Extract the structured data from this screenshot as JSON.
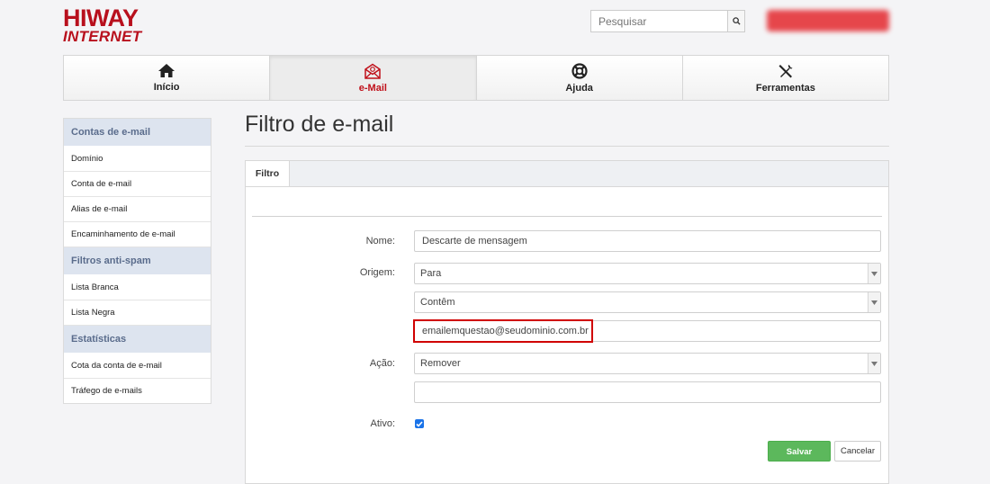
{
  "brand": {
    "line1": "HIWAY",
    "line2": "INTERNET"
  },
  "search": {
    "placeholder": "Pesquisar",
    "icon": "search-icon"
  },
  "topnav": {
    "tabs": [
      {
        "label": "Início",
        "icon": "home-icon",
        "active": false
      },
      {
        "label": "e-Mail",
        "icon": "email-icon",
        "active": true
      },
      {
        "label": "Ajuda",
        "icon": "lifebuoy-icon",
        "active": false
      },
      {
        "label": "Ferramentas",
        "icon": "tools-icon",
        "active": false
      }
    ]
  },
  "sidebar": {
    "sections": [
      {
        "title": "Contas de e-mail",
        "items": [
          "Domínio",
          "Conta de e-mail",
          "Alias de e-mail",
          "Encaminhamento de e-mail"
        ]
      },
      {
        "title": "Filtros anti-spam",
        "items": [
          "Lista Branca",
          "Lista Negra"
        ]
      },
      {
        "title": "Estatísticas",
        "items": [
          "Cota da conta de e-mail",
          "Tráfego de e-mails"
        ]
      }
    ]
  },
  "main": {
    "title": "Filtro de e-mail",
    "tab": "Filtro",
    "form": {
      "nome_label": "Nome:",
      "nome_value": "Descarte de mensagem",
      "origem_label": "Origem:",
      "origem_select": "Para",
      "condicao_select": "Contêm",
      "email_value": "emailemquestao@seudominio.com.br",
      "acao_label": "Ação:",
      "acao_select": "Remover",
      "acao_extra_value": "",
      "ativo_label": "Ativo:",
      "ativo_checked": true
    },
    "buttons": {
      "save": "Salvar",
      "cancel": "Cancelar"
    }
  },
  "colors": {
    "brand": "#b8101d",
    "accent_blue": "#1a73e8",
    "save_green": "#5cb85c",
    "highlight": "#d00000"
  }
}
